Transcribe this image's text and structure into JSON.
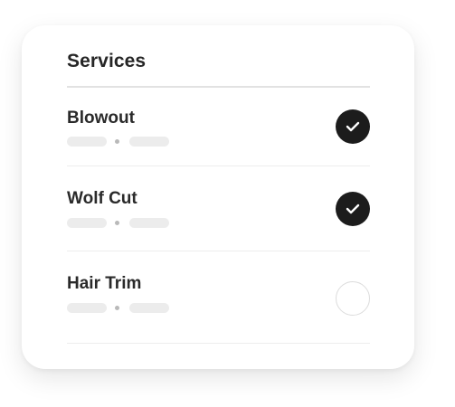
{
  "card": {
    "title": "Services"
  },
  "services": [
    {
      "name": "Blowout",
      "selected": true
    },
    {
      "name": "Wolf Cut",
      "selected": true
    },
    {
      "name": "Hair Trim",
      "selected": false
    }
  ],
  "colors": {
    "selected_fill": "#1c1c1c",
    "check_mark": "#ffffff",
    "placeholder": "#ececec"
  }
}
